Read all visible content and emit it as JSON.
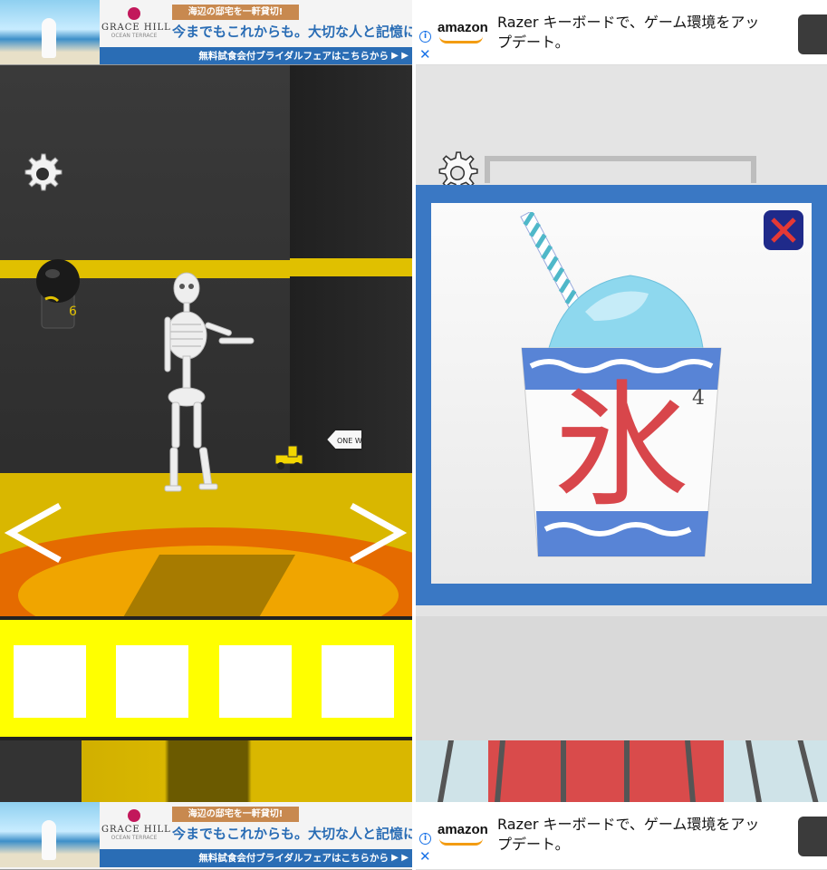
{
  "ads": {
    "gracehill": {
      "brand": "GRACE HILL",
      "brand_sub": "OCEAN TERRACE",
      "tag": "海辺の邸宅を一軒貸切!",
      "headline": "今までもこれからも。大切な人と記憶に残",
      "cta": "無料試食会付ブライダルフェアはこちらから"
    },
    "amazon": {
      "logo": "amazon",
      "text": "Razer キーボードで、ゲーム環境をアップデート。",
      "info_icon": "i",
      "close_icon": "✕"
    }
  },
  "left_scene": {
    "cap_number": "6",
    "sign_text": "ONE WAY",
    "arrow_left": "<",
    "arrow_right": ">"
  },
  "right_scene": {
    "item_kanji": "氷",
    "item_number": "4",
    "item_name": "kakigori-cup"
  },
  "inventory_left": {
    "slots": 4,
    "selected": null
  },
  "inventory_right": {
    "slots": 4,
    "selected": 0,
    "selected_item_kanji": "氷"
  },
  "colors": {
    "left_inventory_bg": "#ffff00",
    "right_inventory_bg": "#00ffff",
    "modal_border": "#3a78c4",
    "wall_stripe": "#e0c000",
    "kanji_red": "#d8464b",
    "close_button": "#1f2a8a"
  }
}
